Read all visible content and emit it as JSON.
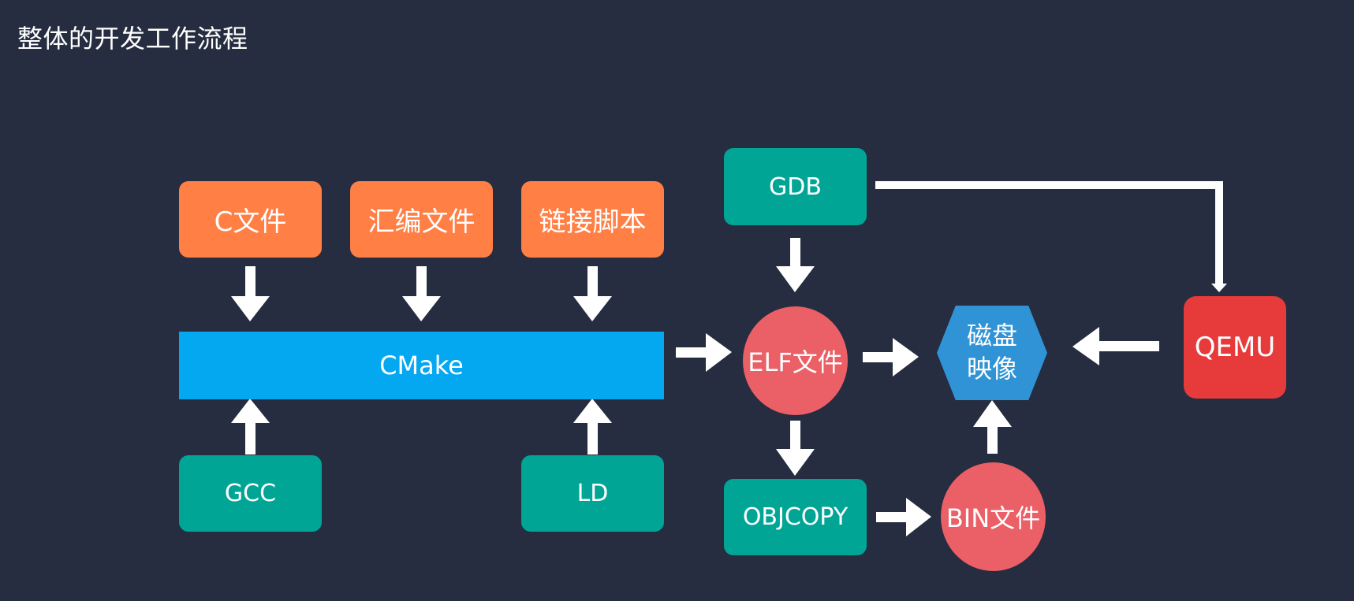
{
  "title": "整体的开发工作流程",
  "nodes": {
    "c_file": "C文件",
    "asm_file": "汇编文件",
    "link_script": "链接脚本",
    "cmake": "CMake",
    "gcc": "GCC",
    "ld": "LD",
    "gdb": "GDB",
    "elf_file": "ELF文件",
    "objcopy": "OBJCOPY",
    "bin_file": "BIN文件",
    "disk_image_line1": "磁盘",
    "disk_image_line2": "映像",
    "qemu": "QEMU"
  },
  "colors": {
    "background": "#262d40",
    "source_nodes": "#ff7f45",
    "tool_nodes": "#00a596",
    "cmake_bar": "#04a8f0",
    "file_circles": "#eb5f66",
    "disk_hexagon": "#2f93d5",
    "qemu_box": "#e73a3b",
    "arrows": "#ffffff"
  }
}
